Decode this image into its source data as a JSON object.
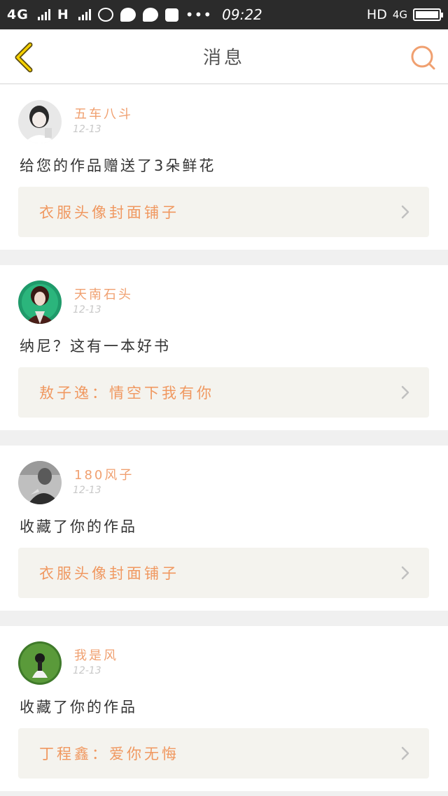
{
  "status_bar": {
    "network_1": "4G",
    "network_2": "H",
    "time": "09:22",
    "hd": "HD",
    "network_3": "4G",
    "dots": "•••"
  },
  "header": {
    "title": "消息",
    "accent_color": "#f0a070",
    "back_icon": "chevron-left-icon",
    "search_icon": "search-icon"
  },
  "messages": [
    {
      "username": "五车八斗",
      "date": "12-13",
      "text": "给您的作品赠送了3朵鲜花",
      "work_title": "衣服头像封面铺子"
    },
    {
      "username": "天南石头",
      "date": "12-13",
      "text": "纳尼？这有一本好书",
      "work_title": "敖子逸：情空下我有你"
    },
    {
      "username": "180风子",
      "date": "12-13",
      "text": "收藏了你的作品",
      "work_title": "衣服头像封面铺子"
    },
    {
      "username": "我是风",
      "date": "12-13",
      "text": "收藏了你的作品",
      "work_title": "丁程鑫：爱你无悔"
    }
  ]
}
